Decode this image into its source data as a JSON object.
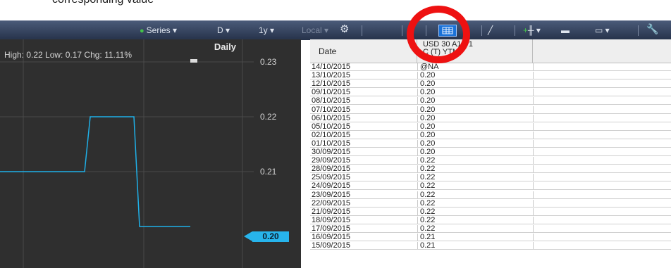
{
  "caption": "corresponding value",
  "toolbar": {
    "series_label": "Series",
    "period_label": "D",
    "range_label": "1y",
    "tz_label": "Local",
    "colors": {
      "bg": "#26324a",
      "accent": "#1a72d8",
      "series_dot": "#44c24a"
    }
  },
  "chart_data": {
    "type": "line",
    "title": "Daily",
    "stats": "High: 0.22 Low: 0.17 Chg: 11.11%",
    "yticks": [
      "0.23",
      "0.22",
      "0.21"
    ],
    "last_value": "0.20",
    "ylim": [
      0.195,
      0.235
    ],
    "x_index": [
      0,
      1,
      2,
      3,
      4,
      5
    ],
    "values": [
      0.21,
      0.21,
      0.22,
      0.22,
      0.2,
      0.2
    ],
    "color": "#1fb0e8",
    "grid": true
  },
  "table": {
    "headers": {
      "date": "Date",
      "security_line1": "USD 30 A1/P1",
      "security_line2": "C (T) YTM"
    },
    "rows": [
      {
        "date": "14/10/2015",
        "value": "@NA"
      },
      {
        "date": "13/10/2015",
        "value": "0.20"
      },
      {
        "date": "12/10/2015",
        "value": "0.20"
      },
      {
        "date": "09/10/2015",
        "value": "0.20"
      },
      {
        "date": "08/10/2015",
        "value": "0.20"
      },
      {
        "date": "07/10/2015",
        "value": "0.20"
      },
      {
        "date": "06/10/2015",
        "value": "0.20"
      },
      {
        "date": "05/10/2015",
        "value": "0.20"
      },
      {
        "date": "02/10/2015",
        "value": "0.20"
      },
      {
        "date": "01/10/2015",
        "value": "0.20"
      },
      {
        "date": "30/09/2015",
        "value": "0.20"
      },
      {
        "date": "29/09/2015",
        "value": "0.22"
      },
      {
        "date": "28/09/2015",
        "value": "0.22"
      },
      {
        "date": "25/09/2015",
        "value": "0.22"
      },
      {
        "date": "24/09/2015",
        "value": "0.22"
      },
      {
        "date": "23/09/2015",
        "value": "0.22"
      },
      {
        "date": "22/09/2015",
        "value": "0.22"
      },
      {
        "date": "21/09/2015",
        "value": "0.22"
      },
      {
        "date": "18/09/2015",
        "value": "0.22"
      },
      {
        "date": "17/09/2015",
        "value": "0.22"
      },
      {
        "date": "16/09/2015",
        "value": "0.21"
      },
      {
        "date": "15/09/2015",
        "value": "0.21"
      }
    ]
  },
  "annotation": {
    "color": "#ee1111"
  }
}
